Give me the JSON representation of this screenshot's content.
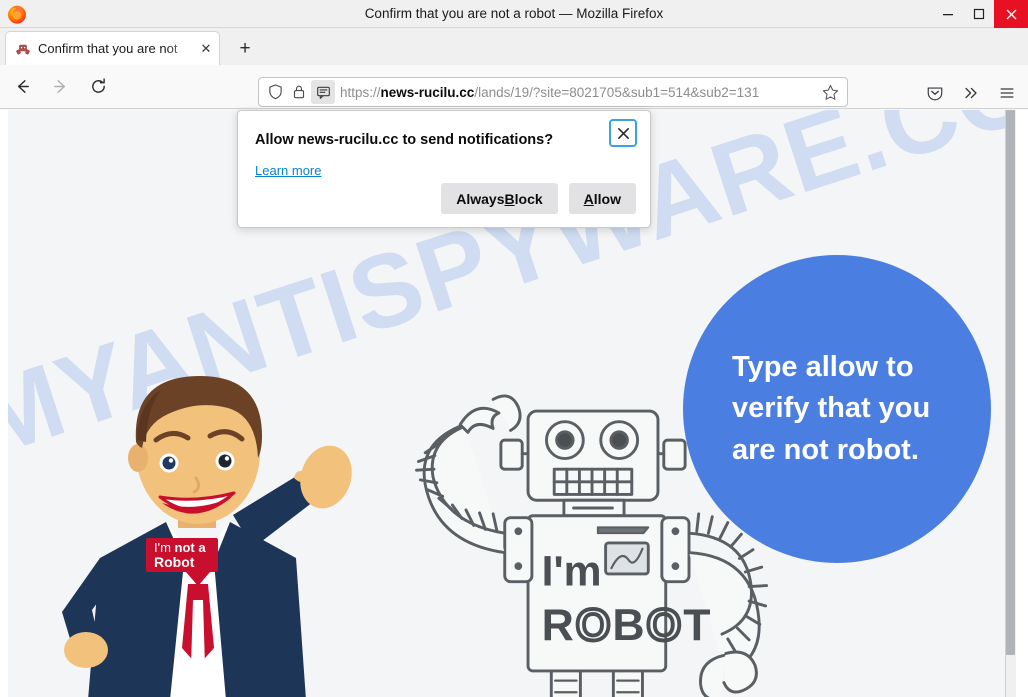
{
  "window": {
    "title": "Confirm that you are not a robot — Mozilla Firefox",
    "minimize_label": "—",
    "maximize_label": "▢",
    "close_label": "✕"
  },
  "tabs": {
    "items": [
      {
        "label": "Confirm that you are not",
        "close_label": "✕",
        "favicon": "robot-favicon"
      }
    ],
    "new_tab_label": "+"
  },
  "toolbar": {
    "back_label": "←",
    "forward_label": "→",
    "reload_label": "⟳",
    "shield_icon": "shield-icon",
    "lock_icon": "padlock-icon",
    "notification_icon": "notification-bubble-icon",
    "bookmark_star_label": "☆",
    "pocket_icon": "pocket-icon",
    "overflow_label": "»",
    "menu_label": "≡"
  },
  "urlbar": {
    "scheme": "https://",
    "domain": "news-rucilu.cc",
    "path": "/lands/19/?site=8021705&sub1=514&sub2=131",
    "full_url": "https://news-rucilu.cc/lands/19/?site=8021705&sub1=514&sub2=131"
  },
  "popup": {
    "title": "Allow news-rucilu.cc to send notifications?",
    "learn_more": "Learn more",
    "close_label": "✕",
    "buttons": [
      {
        "name": "always-block",
        "prefix": "Always ",
        "accesskey": "B",
        "suffix": "lock"
      },
      {
        "name": "allow",
        "prefix": "",
        "accesskey": "A",
        "suffix": "llow"
      }
    ],
    "always_block_label": "Always Block",
    "allow_label": "Allow"
  },
  "page": {
    "watermark": "MYANTISPYWARE.COM",
    "circle_text": "Type allow to verify that you are not robot.",
    "man_badge_line1": "I'm not a",
    "man_badge_line2": "Robot",
    "robot_text_line1": "I'm",
    "robot_text_line2": "ROBOT"
  },
  "colors": {
    "accent_blue": "#4a7ee0",
    "watermark_blue": "#b9cdf0",
    "badge_red": "#c8102e",
    "suit_navy": "#1d3557",
    "tie_red": "#c8102e",
    "skin": "#f0bf7f",
    "hair": "#6b4226",
    "close_button_red": "#e81123",
    "link_blue": "#0a84c8",
    "focus_ring_blue": "#3aa2e3"
  }
}
